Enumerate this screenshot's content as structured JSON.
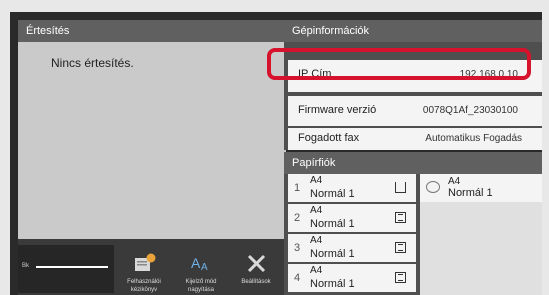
{
  "notifications": {
    "title": "Értesítés",
    "empty_text": "Nincs értesítés."
  },
  "machine_info": {
    "title": "Gépinformációk",
    "ip_label": "IP Cím",
    "ip_value": "192.168.0.10",
    "firmware_label": "Firmware verzió",
    "firmware_value": "0078Q1Af_23030100",
    "fax_label": "Fogadott fax",
    "fax_value": "Automatikus Fogadás"
  },
  "paper_trays": {
    "title": "Papírfiók",
    "trays": [
      {
        "number": "1",
        "size": "A4",
        "type": "Normál 1"
      },
      {
        "number": "2",
        "size": "A4",
        "type": "Normál 1"
      },
      {
        "number": "3",
        "size": "A4",
        "type": "Normál 1"
      },
      {
        "number": "4",
        "size": "A4",
        "type": "Normál 1"
      }
    ],
    "bypass": {
      "size": "A4",
      "type": "Normál 1"
    }
  },
  "toolbar": {
    "toner_label": "Bk",
    "manual_label_line1": "Felhasználói",
    "manual_label_line2": "kézikönyv",
    "zoom_label_line1": "Kijelző mód",
    "zoom_label_line2": "nagyítása",
    "settings_label": "Beállítások"
  },
  "colors": {
    "highlight": "#d6122c",
    "panel_header": "#606060",
    "background": "#2a2a2a"
  }
}
